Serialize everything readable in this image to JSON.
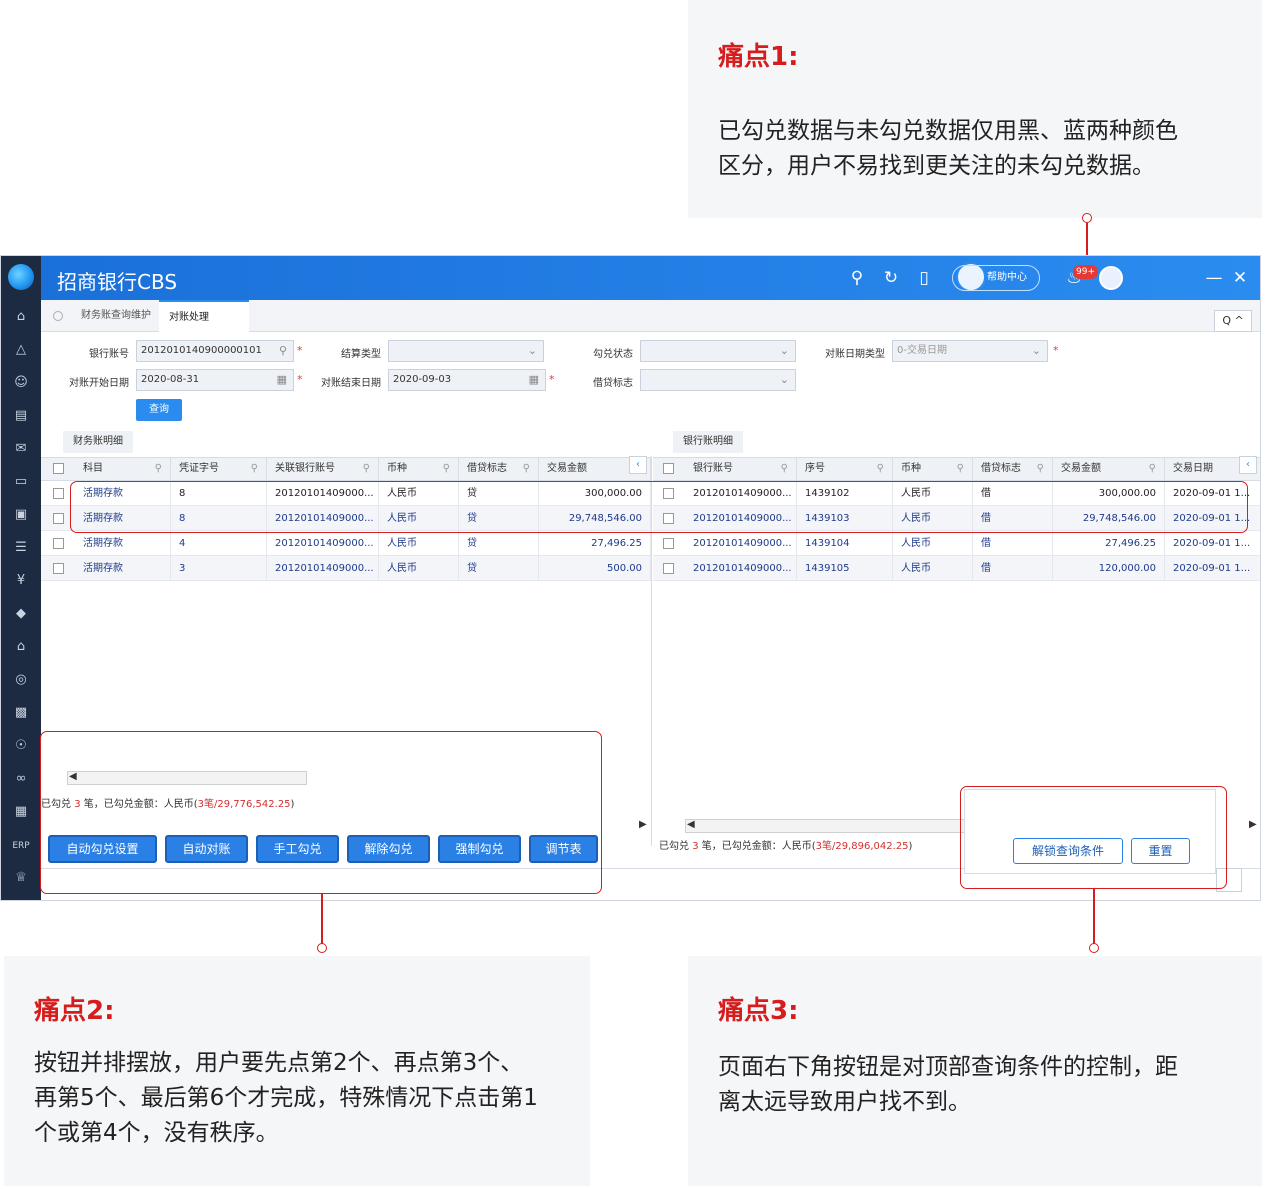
{
  "pain_points": [
    {
      "title": "痛点1:",
      "body": [
        "已勾兑数据与未勾兑数据仅用黑、蓝两种颜色",
        "区分，用户不易找到更关注的未勾兑数据。"
      ]
    },
    {
      "title": "痛点2:",
      "body": [
        "按钮并排摆放，用户要先点第2个、再点第3个、",
        "再第5个、最后第6个才完成，特殊情况下点击第1",
        "个或第4个，没有秩序。"
      ]
    },
    {
      "title": "痛点3:",
      "body": [
        "页面右下角按钮是对顶部查询条件的控制，距",
        "离太远导致用户找不到。"
      ]
    }
  ],
  "app": {
    "title": "招商银行CBS",
    "help_label": "帮助中心",
    "notification_count": "99+",
    "sidebar_last_label": "ERP",
    "tabs": [
      "财务账查询维护",
      "对账处理"
    ],
    "search_toggle": "Q ^"
  },
  "form": {
    "bank_account_label": "银行账号",
    "bank_account_value": "2012010140900000101",
    "settle_type_label": "结算类型",
    "check_status_label": "勾兑状态",
    "recon_date_type_label": "对账日期类型",
    "recon_date_type_value": "0-交易日期",
    "start_date_label": "对账开始日期",
    "start_date_value": "2020-08-31",
    "end_date_label": "对账结束日期",
    "end_date_value": "2020-09-03",
    "dc_flag_label": "借贷标志",
    "query_button": "查询"
  },
  "left_table": {
    "panel_title": "财务账明细",
    "columns": [
      "科目",
      "凭证字号",
      "关联银行账号",
      "币种",
      "借贷标志",
      "交易金额"
    ],
    "rows": [
      [
        "活期存款",
        "8",
        "20120101409000...",
        "人民币",
        "贷",
        "300,000.00"
      ],
      [
        "活期存款",
        "8",
        "20120101409000...",
        "人民币",
        "贷",
        "29,748,546.00"
      ],
      [
        "活期存款",
        "4",
        "20120101409000...",
        "人民币",
        "贷",
        "27,496.25"
      ],
      [
        "活期存款",
        "3",
        "20120101409000...",
        "人民币",
        "贷",
        "500.00"
      ]
    ],
    "summary_prefix": "已勾兑",
    "summary_count": "3",
    "summary_mid": "笔，已勾兑金额：人民币(",
    "summary_value": "3笔/29,776,542.25",
    "summary_suffix": ")"
  },
  "right_table": {
    "panel_title": "银行账明细",
    "columns": [
      "银行账号",
      "序号",
      "币种",
      "借贷标志",
      "交易金额",
      "交易日期"
    ],
    "rows": [
      [
        "20120101409000...",
        "1439102",
        "人民币",
        "借",
        "300,000.00",
        "2020-09-01 1..."
      ],
      [
        "20120101409000...",
        "1439103",
        "人民币",
        "借",
        "29,748,546.00",
        "2020-09-01 1..."
      ],
      [
        "20120101409000...",
        "1439104",
        "人民币",
        "借",
        "27,496.25",
        "2020-09-01 1..."
      ],
      [
        "20120101409000...",
        "1439105",
        "人民币",
        "借",
        "120,000.00",
        "2020-09-01 1..."
      ]
    ],
    "summary_prefix": "已勾兑",
    "summary_count": "3",
    "summary_mid": "笔，已勾兑金额：人民币(",
    "summary_value": "3笔/29,896,042.25",
    "summary_suffix": ")"
  },
  "actions": [
    "自动勾兑设置",
    "自动对账",
    "手工勾兑",
    "解除勾兑",
    "强制勾兑",
    "调节表"
  ],
  "query_controls": [
    "解锁查询条件",
    "重置"
  ]
}
